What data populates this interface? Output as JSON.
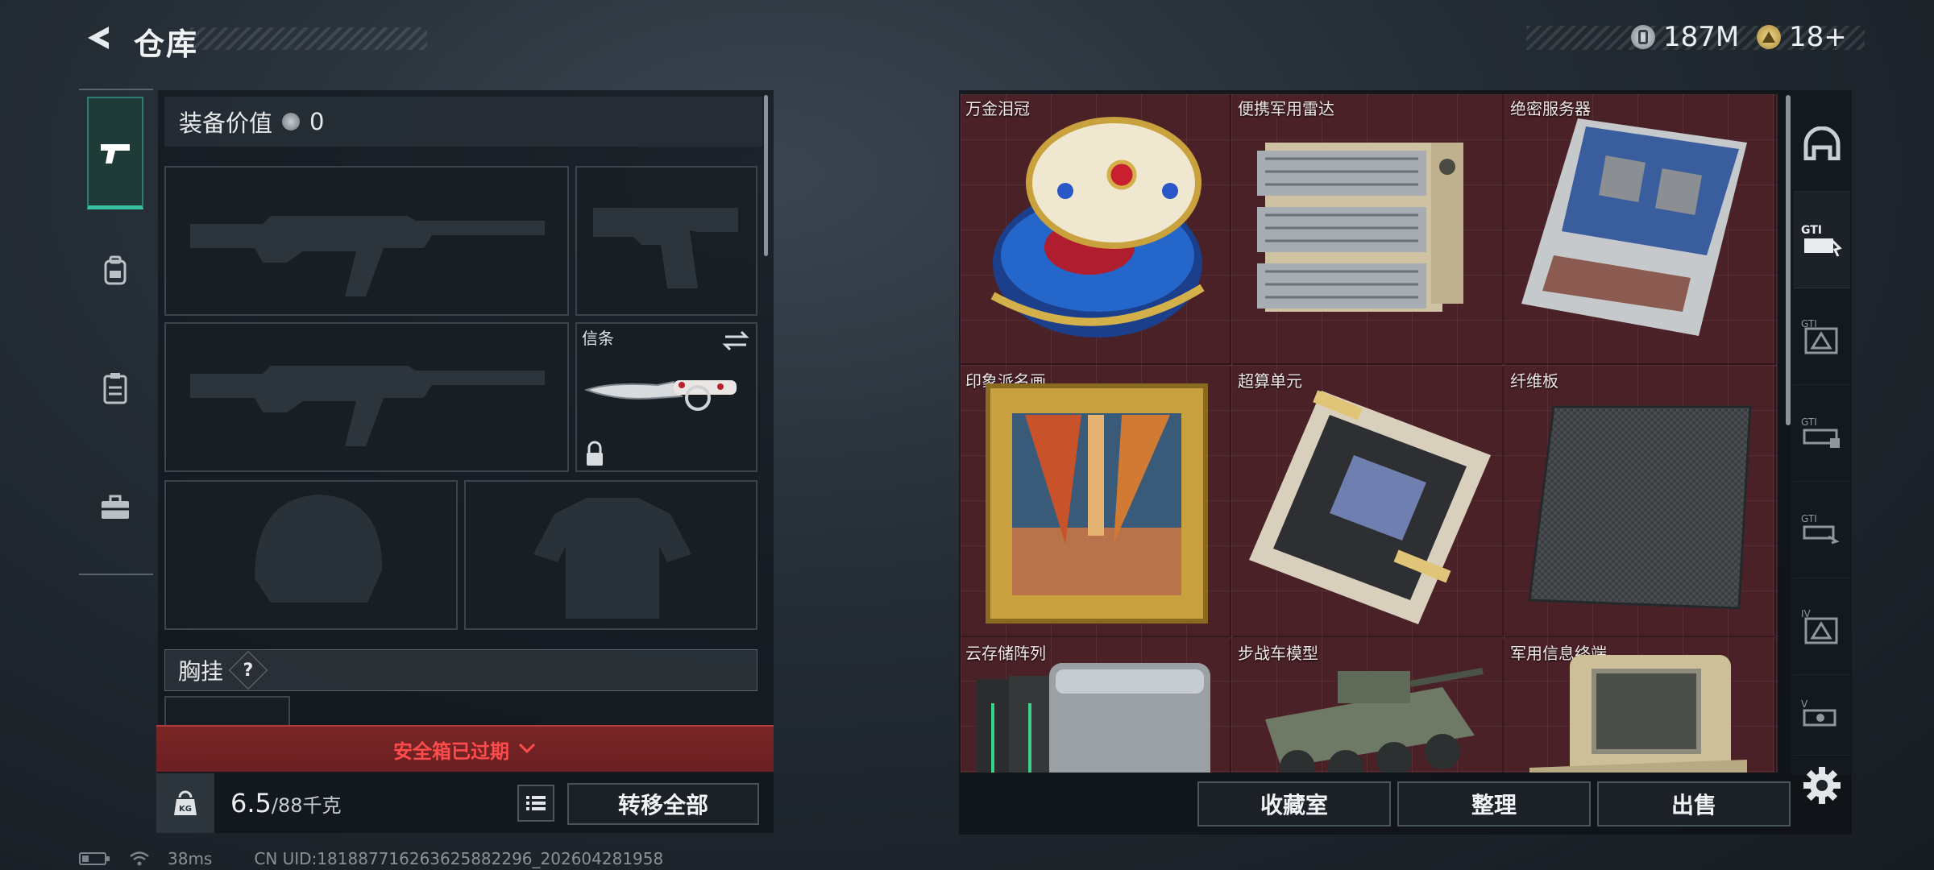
{
  "header": {
    "title": "仓库",
    "currency": {
      "amount": "187M",
      "icon": "silver-coin-icon"
    },
    "tickets": {
      "amount": "18+",
      "icon": "gold-coin-icon"
    }
  },
  "left_nav": {
    "items": [
      {
        "icon": "pistol-icon",
        "active": true
      },
      {
        "icon": "backpack-icon",
        "active": false
      },
      {
        "icon": "clipboard-icon",
        "active": false
      },
      {
        "icon": "briefcase-icon",
        "active": false
      }
    ]
  },
  "equipment": {
    "value_label": "装备价值",
    "value": "0",
    "melee_label": "信条",
    "chest_rig_label": "胸挂",
    "chest_rig_help": "?",
    "safebox_status": "安全箱已过期",
    "weight_value": "6.5",
    "weight_capacity": "/88千克",
    "transfer_all_label": "转移全部"
  },
  "stash": {
    "items": [
      {
        "name": "万金泪冠"
      },
      {
        "name": "便携军用雷达"
      },
      {
        "name": "绝密服务器"
      },
      {
        "name": "印象派名画"
      },
      {
        "name": "超算单元"
      },
      {
        "name": "纤维板"
      },
      {
        "name": "云存储阵列"
      },
      {
        "name": "步战车模型"
      },
      {
        "name": "军用信息终端"
      }
    ],
    "buttons": {
      "collection": "收藏室",
      "organize": "整理",
      "sell": "出售"
    }
  },
  "right_nav": {
    "items": [
      "helmet-tab-icon",
      "gti-tab-icon",
      "gti-tab-2-icon",
      "gti-tab-3-icon",
      "gti-tab-4-icon",
      "iv-tab-icon",
      "v-tab-icon"
    ]
  },
  "status_bar": {
    "ping": "38ms",
    "uid": "CN UID:18188771626362588229​6_202604281958"
  },
  "colors": {
    "accent_teal": "#37c2a3",
    "alert_red": "#ff4b4b",
    "stash_bg": "#4a2127"
  }
}
